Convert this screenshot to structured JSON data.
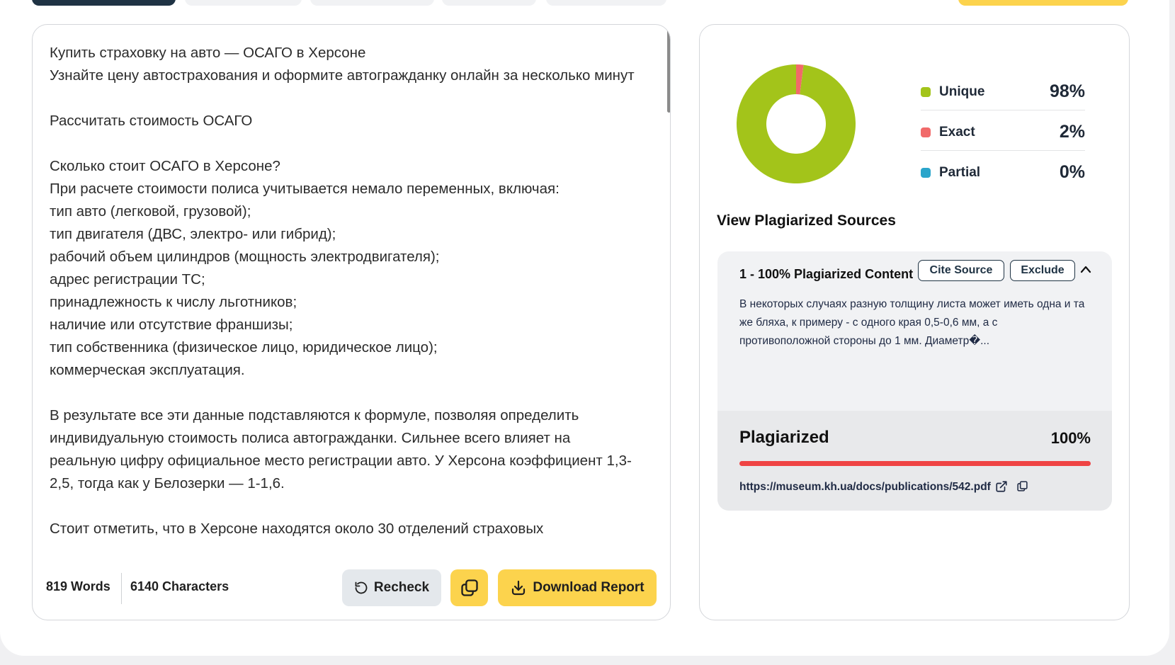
{
  "colors": {
    "accent_yellow": "#fcd34d",
    "navy": "#1f3344",
    "unique": "#a3c41a",
    "exact": "#f16a6a",
    "partial": "#2aa5cb",
    "plagiarized_bar": "#ef4444"
  },
  "editor": {
    "paragraphs": [
      "Купить страховку на авто — ОСАГО в Херсоне",
      "Узнайте цену автострахования и оформите автогражданку онлайн за несколько минут",
      "",
      "Рассчитать стоимость ОСАГО",
      "",
      "Сколько стоит ОСАГО в Херсоне?",
      "При расчете стоимости полиса учитывается немало переменных, включая:",
      "тип авто (легковой, грузовой);",
      "тип двигателя (ДВС, электро- или гибрид);",
      "рабочий объем цилиндров (мощность электродвигателя);",
      "адрес регистрации ТС;",
      "принадлежность к числу льготников;",
      "наличие или отсутствие франшизы;",
      "тип собственника (физическое лицо, юридическое лицо);",
      "коммерческая эксплуатация.",
      "",
      "В результате все эти данные подставляются к формуле, позволяя определить индивидуальную стоимость полиса автогражданки. Сильнее всего влияет на реальную цифру официальное место регистрации авто. У Херсона коэффициент 1,3-2,5, тогда как у Белозерки — 1-1,6.",
      "",
      "Стоит отметить, что в Херсоне находятся около 30 отделений страховых"
    ],
    "words_label": "819 Words",
    "characters_label": "6140 Characters",
    "recheck_label": "Recheck",
    "download_label": "Download Report",
    "copy_icon": "copy-icon",
    "recheck_icon": "refresh-icon",
    "download_icon": "download-icon"
  },
  "report": {
    "chart_data": {
      "type": "pie",
      "categories": [
        "Unique",
        "Exact",
        "Partial"
      ],
      "values": [
        98,
        2,
        0
      ],
      "colors": [
        "#a3c41a",
        "#f16a6a",
        "#2aa5cb"
      ],
      "title": ""
    },
    "legend": [
      {
        "label": "Unique",
        "value": "98%"
      },
      {
        "label": "Exact",
        "value": "2%"
      },
      {
        "label": "Partial",
        "value": "0%"
      }
    ],
    "sources_heading": "View Plagiarized Sources",
    "source": {
      "title": "1 - 100% Plagiarized Content",
      "cite_label": "Cite Source",
      "exclude_label": "Exclude",
      "snippet": "В некоторых случаях разную толщину листа может иметь одна и та же бляха, к примеру - с одного края 0,5-0,6 мм, а с противоположной стороны до 1 мм. Диаметр�...",
      "plagiarized_label": "Plagiarized",
      "plagiarized_value": "100%",
      "plagiarized_fraction": 1.0,
      "url": "https://museum.kh.ua/docs/publications/542.pdf"
    }
  }
}
